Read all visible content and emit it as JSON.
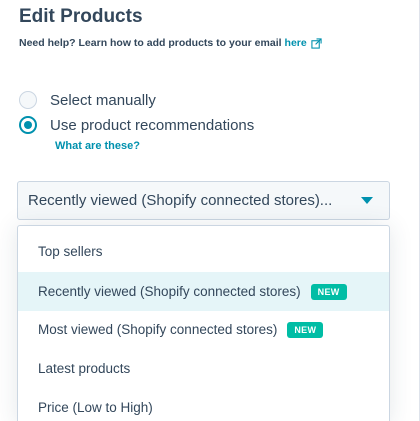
{
  "header": {
    "title": "Edit Products",
    "help_text": "Need help? Learn how to add products to your email",
    "help_link": "here"
  },
  "options": {
    "manual_label": "Select manually",
    "recommend_label": "Use product recommendations",
    "selected": "recommend",
    "what_link": "What are these?"
  },
  "select": {
    "value": "Recently viewed (Shopify connected stores)..."
  },
  "dropdown": {
    "items": [
      {
        "label": "Top sellers",
        "badge": ""
      },
      {
        "label": "Recently viewed (Shopify connected stores)",
        "badge": "NEW"
      },
      {
        "label": "Most viewed (Shopify connected stores)",
        "badge": "NEW"
      },
      {
        "label": "Latest products",
        "badge": ""
      },
      {
        "label": "Price (Low to High)",
        "badge": ""
      }
    ],
    "active_index": 1
  },
  "colors": {
    "accent": "#0091ae",
    "badge": "#00bda5",
    "highlight": "#e5f5f8",
    "text": "#33475b"
  },
  "icons": {
    "external_link": "external-link-icon",
    "caret": "chevron-down-icon"
  }
}
